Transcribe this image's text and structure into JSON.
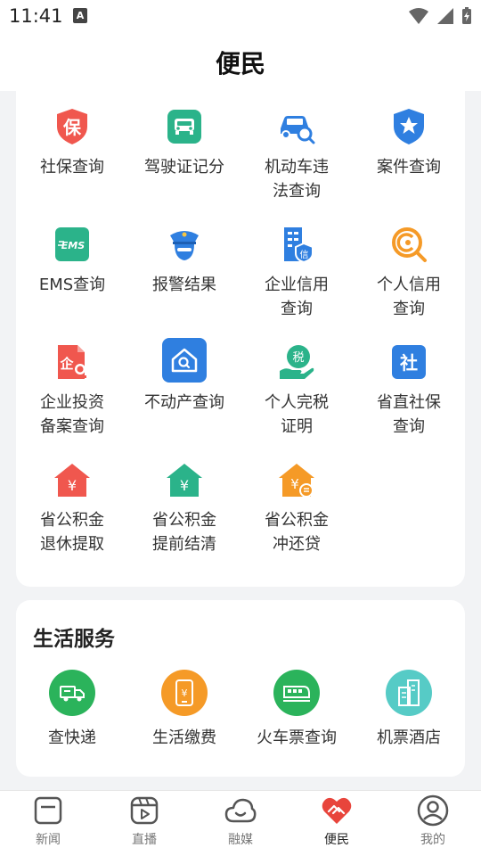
{
  "status": {
    "time": "11:41",
    "badge": "A"
  },
  "header": {
    "title": "便民"
  },
  "services": [
    {
      "label": "社保查询",
      "icon": "shield-bao-icon",
      "color": "#f0574e"
    },
    {
      "label": "驾驶证记分",
      "icon": "car-front-icon",
      "color": "#2bb38a"
    },
    {
      "label": "机动车违\n法查询",
      "icon": "car-search-icon",
      "color": "#2f7fe0"
    },
    {
      "label": "案件查询",
      "icon": "star-shield-icon",
      "color": "#2f7fe0"
    },
    {
      "label": "EMS查询",
      "icon": "ems-icon",
      "color": "#2bb38a"
    },
    {
      "label": "报警结果",
      "icon": "police-icon",
      "color": "#2f7fe0"
    },
    {
      "label": "企业信用\n查询",
      "icon": "building-credit-icon",
      "color": "#2f7fe0"
    },
    {
      "label": "个人信用\n查询",
      "icon": "credit-search-icon",
      "color": "#f59a27"
    },
    {
      "label": "企业投资\n备案查询",
      "icon": "enterprise-doc-icon",
      "color": "#f0574e"
    },
    {
      "label": "不动产查询",
      "icon": "house-search-icon",
      "color": "#2f7fe0"
    },
    {
      "label": "个人完税\n证明",
      "icon": "tax-hand-icon",
      "color": "#2bb38a"
    },
    {
      "label": "省直社保\n查询",
      "icon": "she-badge-icon",
      "color": "#2f7fe0"
    },
    {
      "label": "省公积金\n退休提取",
      "icon": "house-yuan-red-icon",
      "color": "#f0574e"
    },
    {
      "label": "省公积金\n提前结清",
      "icon": "house-yuan-green-icon",
      "color": "#2bb38a"
    },
    {
      "label": "省公积金\n冲还贷",
      "icon": "house-yuan-orange-icon",
      "color": "#f59a27"
    }
  ],
  "life": {
    "title": "生活服务",
    "items": [
      {
        "label": "查快递",
        "icon": "truck-icon",
        "color": "#2bb35b"
      },
      {
        "label": "生活缴费",
        "icon": "phone-yuan-icon",
        "color": "#f59a27"
      },
      {
        "label": "火车票查询",
        "icon": "train-icon",
        "color": "#2bb35b"
      },
      {
        "label": "机票酒店",
        "icon": "hotel-icon",
        "color": "#56cbc6"
      }
    ]
  },
  "tabs": [
    {
      "label": "新闻",
      "icon": "news-icon"
    },
    {
      "label": "直播",
      "icon": "live-icon"
    },
    {
      "label": "融媒",
      "icon": "cloud-icon"
    },
    {
      "label": "便民",
      "icon": "heart-hand-icon",
      "active": true
    },
    {
      "label": "我的",
      "icon": "profile-icon"
    }
  ]
}
